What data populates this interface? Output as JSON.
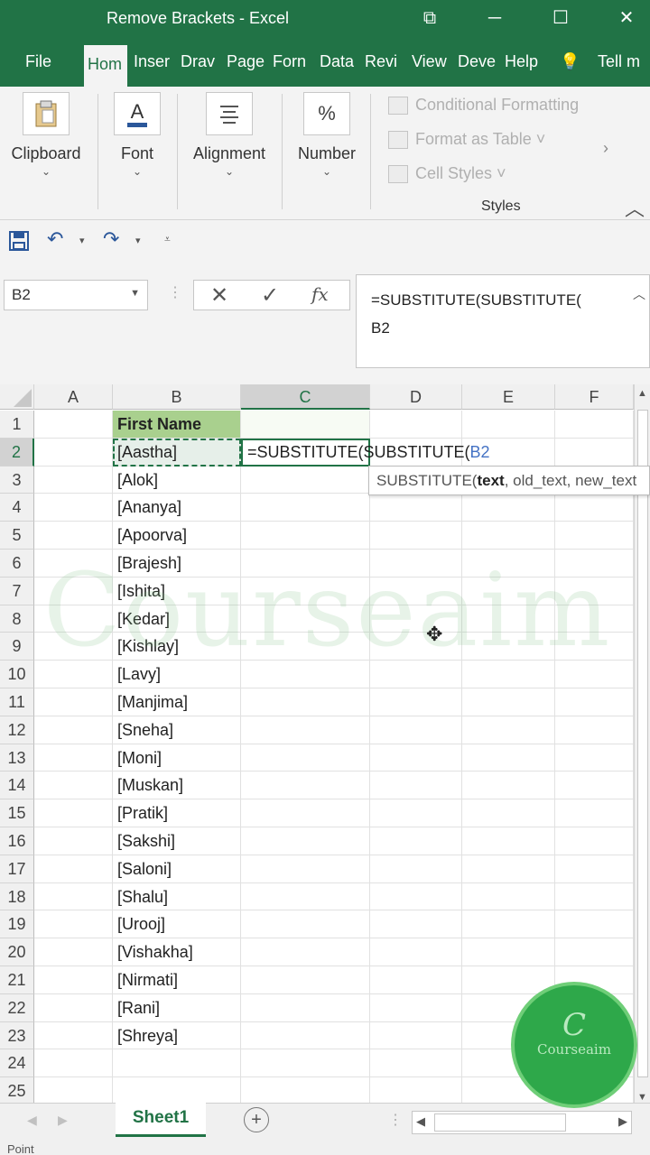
{
  "window": {
    "title": "Remove Brackets  -  Excel",
    "controls": [
      "⧉",
      "─",
      "☐",
      "✕"
    ]
  },
  "ribbon_tabs": [
    "File",
    "Hom",
    "Inser",
    "Drav",
    "Page",
    "Forn",
    "Data",
    "Revi",
    "View",
    "Deve",
    "Help",
    "💡",
    "Tell m"
  ],
  "ribbon": {
    "clipboard": "Clipboard",
    "font": "Font",
    "alignment": "Alignment",
    "number": "Number",
    "number_icon": "%",
    "conditional_formatting": "Conditional Formatting",
    "format_as_table": "Format as Table ˅",
    "cell_styles": "Cell Styles ˅",
    "styles_label": "Styles"
  },
  "formula": {
    "name_box": "B2",
    "fx": "fx",
    "line1": "=SUBSTITUTE(SUBSTITUTE(",
    "line2": "B2"
  },
  "columns": [
    "A",
    "B",
    "C",
    "D",
    "E",
    "F"
  ],
  "rows": [
    {
      "num": "1",
      "b": "First Name"
    },
    {
      "num": "2",
      "b": "[Aastha]"
    },
    {
      "num": "3",
      "b": "[Alok]"
    },
    {
      "num": "4",
      "b": "[Ananya]"
    },
    {
      "num": "5",
      "b": "[Apoorva]"
    },
    {
      "num": "6",
      "b": "[Brajesh]"
    },
    {
      "num": "7",
      "b": "[Ishita]"
    },
    {
      "num": "8",
      "b": "[Kedar]"
    },
    {
      "num": "9",
      "b": "[Kishlay]"
    },
    {
      "num": "10",
      "b": "[Lavy]"
    },
    {
      "num": "11",
      "b": "[Manjima]"
    },
    {
      "num": "12",
      "b": "[Sneha]"
    },
    {
      "num": "13",
      "b": "[Moni]"
    },
    {
      "num": "14",
      "b": "[Muskan]"
    },
    {
      "num": "15",
      "b": "[Pratik]"
    },
    {
      "num": "16",
      "b": "[Sakshi]"
    },
    {
      "num": "17",
      "b": "[Saloni]"
    },
    {
      "num": "18",
      "b": "[Shalu]"
    },
    {
      "num": "19",
      "b": "[Urooj]"
    },
    {
      "num": "20",
      "b": "[Vishakha]"
    },
    {
      "num": "21",
      "b": "[Nirmati]"
    },
    {
      "num": "22",
      "b": "[Rani]"
    },
    {
      "num": "23",
      "b": "[Shreya]"
    },
    {
      "num": "24",
      "b": ""
    },
    {
      "num": "25",
      "b": ""
    }
  ],
  "edit_cell": {
    "prefix": "=SUBSTITUTE(SUBSTITUTE(",
    "ref": "B2",
    "ref_color": "#4472c4"
  },
  "tooltip": {
    "fn": "SUBSTITUTE(",
    "arg1": "text",
    "rest": ", old_text, new_text"
  },
  "watermark": "Courseaim",
  "logo": {
    "mark": "C",
    "text": "Courseaim"
  },
  "sheet_tab": "Sheet1",
  "status": "Point",
  "colors": {
    "excel_green": "#217346",
    "header_fill": "#a9d08e",
    "logo_green": "#2ea84a"
  }
}
